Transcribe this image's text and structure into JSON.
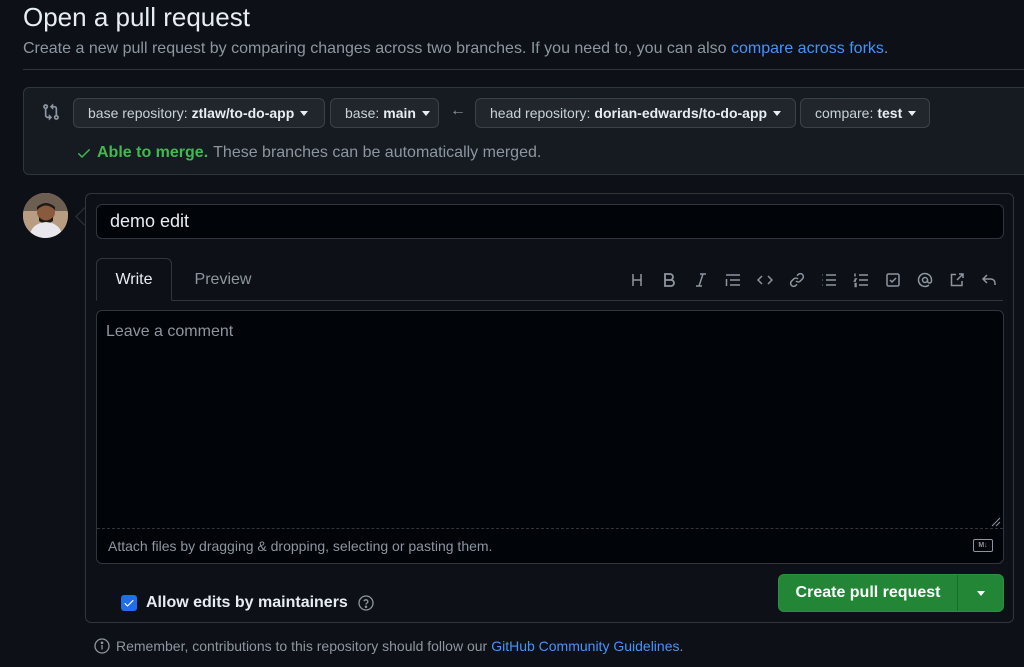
{
  "header": {
    "title": "Open a pull request",
    "subtitle": "Create a new pull request by comparing changes across two branches. If you need to, you can also",
    "subtitle_link": "compare across forks",
    "subtitle_end": "."
  },
  "compare": {
    "base_repo_label": "base repository:",
    "base_repo_value": "ztlaw/to-do-app",
    "base_label": "base:",
    "base_value": "main",
    "head_repo_label": "head repository:",
    "head_repo_value": "dorian-edwards/to-do-app",
    "compare_label": "compare:",
    "compare_value": "test",
    "merge_ok": "Able to merge.",
    "merge_text": "These branches can be automatically merged."
  },
  "form": {
    "title_value": "demo edit",
    "tab_write": "Write",
    "tab_preview": "Preview",
    "comment_placeholder": "Leave a comment",
    "attach_text": "Attach files by dragging & dropping, selecting or pasting them.",
    "md_badge": "M↓",
    "allow_edits": "Allow edits by maintainers",
    "create_button": "Create pull request"
  },
  "toolbar": {
    "items": [
      "heading-icon",
      "bold-icon",
      "italic-icon",
      "quote-icon",
      "code-icon",
      "link-icon",
      "unordered-list-icon",
      "ordered-list-icon",
      "task-list-icon",
      "mention-icon",
      "reference-icon",
      "reply-icon"
    ]
  },
  "footer": {
    "text": "Remember, contributions to this repository should follow our",
    "link": "GitHub Community Guidelines",
    "end": "."
  },
  "colors": {
    "background": "#0d1117",
    "accent_link": "#4493f8",
    "success": "#3fb950",
    "primary_button": "#238636"
  }
}
